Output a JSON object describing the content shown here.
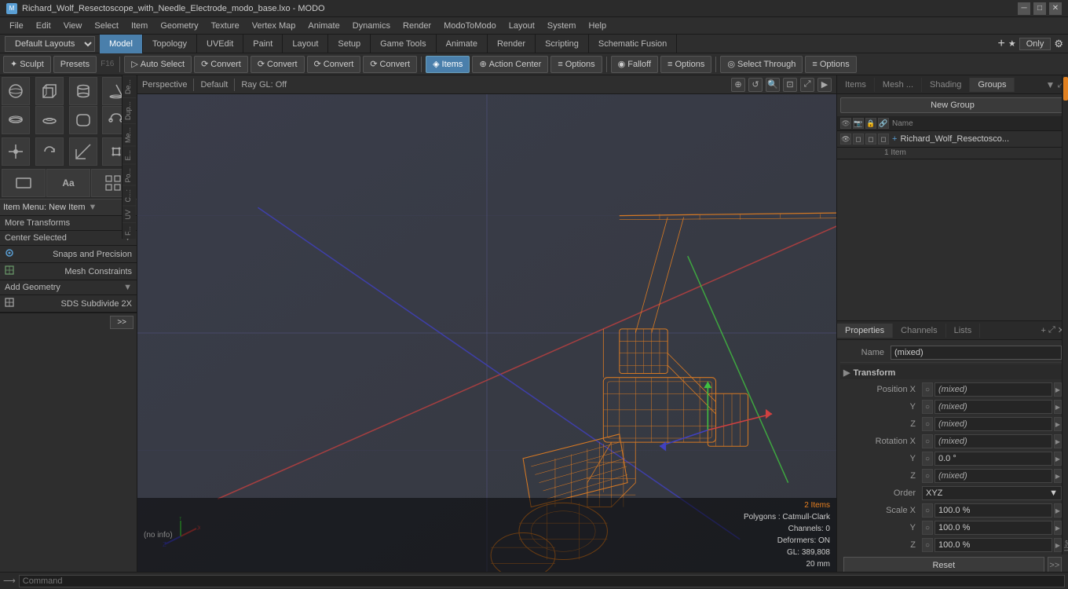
{
  "titleBar": {
    "title": "Richard_Wolf_Resectoscope_with_Needle_Electrode_modo_base.lxo - MODO",
    "minimize": "─",
    "maximize": "□",
    "close": "✕"
  },
  "menuBar": {
    "items": [
      "File",
      "Edit",
      "View",
      "Select",
      "Item",
      "Geometry",
      "Texture",
      "Vertex Map",
      "Animate",
      "Dynamics",
      "Render",
      "ModoToModo",
      "Layout",
      "System",
      "Help"
    ]
  },
  "tabBar1": {
    "layouts_label": "Default Layouts",
    "tabs": [
      "Model",
      "Topology",
      "UVEdit",
      "Paint",
      "Layout",
      "Setup",
      "Game Tools",
      "Animate",
      "Render",
      "Scripting",
      "Schematic Fusion"
    ],
    "active": "Model",
    "plus": "+",
    "star": "★",
    "only": "Only"
  },
  "toolBar": {
    "sculpt": "Sculpt",
    "presets": "Presets",
    "f16": "F16",
    "buttons": [
      {
        "id": "auto-select",
        "label": "Auto Select",
        "icon": "▷"
      },
      {
        "id": "convert1",
        "label": "Convert",
        "icon": "⟳"
      },
      {
        "id": "convert2",
        "label": "Convert",
        "icon": "⟳"
      },
      {
        "id": "convert3",
        "label": "Convert",
        "icon": "⟳"
      },
      {
        "id": "convert4",
        "label": "Convert",
        "icon": "⟳"
      },
      {
        "id": "items",
        "label": "Items",
        "icon": "◈",
        "active": true
      },
      {
        "id": "action-center",
        "label": "Action Center",
        "icon": "⊕"
      },
      {
        "id": "options1",
        "label": "Options",
        "icon": "≡"
      },
      {
        "id": "falloff",
        "label": "Falloff",
        "icon": "◉"
      },
      {
        "id": "options2",
        "label": "Options",
        "icon": "≡"
      },
      {
        "id": "select-through",
        "label": "Select Through",
        "icon": "◎"
      },
      {
        "id": "options3",
        "label": "Options",
        "icon": "≡"
      }
    ]
  },
  "viewport": {
    "label1": "Perspective",
    "label2": "Default",
    "label3": "Ray GL: Off",
    "statusItems": [
      "2 Items",
      "Polygons : Catmull-Clark",
      "Channels: 0",
      "Deformers: ON",
      "GL: 389,808",
      "20 mm"
    ],
    "noInfo": "(no info)"
  },
  "leftPanel": {
    "vertTabs": [
      "De...",
      "Dup...",
      "Me...",
      "E...",
      "Po...",
      "C...:",
      "UV",
      "F..."
    ],
    "toolIcons": [
      {
        "icon": "⬡",
        "title": "Sphere"
      },
      {
        "icon": "⬢",
        "title": "Box"
      },
      {
        "icon": "⬤",
        "title": "Cylinder"
      },
      {
        "icon": "▲",
        "title": "Cone"
      },
      {
        "icon": "◈",
        "title": "Disc"
      },
      {
        "icon": "⊙",
        "title": "Torus"
      },
      {
        "icon": "⌬",
        "title": "Capsule"
      },
      {
        "icon": "⟲",
        "title": "Pipe"
      }
    ],
    "toolIcons2": [
      {
        "icon": "⬙",
        "title": "Move"
      },
      {
        "icon": "⟳",
        "title": "Rotate"
      },
      {
        "icon": "⤢",
        "title": "Scale"
      },
      {
        "icon": "✥",
        "title": "Transform"
      },
      {
        "icon": "⊞",
        "title": "Type"
      },
      {
        "icon": "Aa",
        "title": "Text"
      }
    ],
    "itemMenu": "Item Menu: New Item",
    "sections": [
      {
        "label": "More Transforms",
        "expanded": true,
        "items": []
      },
      {
        "label": "Center Selected",
        "items": []
      },
      {
        "label": "Snaps and Precision",
        "items": [],
        "icon": "snap"
      },
      {
        "label": "Mesh Constraints",
        "items": [],
        "icon": "mesh"
      },
      {
        "label": "Add Geometry",
        "expanded": true,
        "items": []
      },
      {
        "label": "SDS Subdivide 2X",
        "items": [],
        "icon": "sds"
      }
    ],
    "moreBtn": ">>"
  },
  "rightPanel": {
    "topTabs": [
      "Items",
      "Mesh ...",
      "Shading",
      "Groups"
    ],
    "activeTab": "Groups",
    "newGroupBtn": "New Group",
    "listColumns": [
      "Name"
    ],
    "groups": [
      {
        "name": "Richard_Wolf_Resectosco...",
        "count": "1 Item"
      }
    ],
    "properties": {
      "tabs": [
        "Properties",
        "Channels",
        "Lists"
      ],
      "activeTab": "Properties",
      "plusBtn": "+",
      "name": "(mixed)",
      "transform": {
        "posX": "(mixed)",
        "posY": "(mixed)",
        "posZ": "(mixed)",
        "rotX": "(mixed)",
        "rotY": "0.0 °",
        "rotZ": "(mixed)",
        "order": "XYZ",
        "scaleX": "100.0 %",
        "scaleY": "100.0 %",
        "scaleZ": "100.0 %"
      },
      "resetBtn": "Reset"
    }
  },
  "commandBar": {
    "prompt": "⟶",
    "placeholder": "Command"
  }
}
